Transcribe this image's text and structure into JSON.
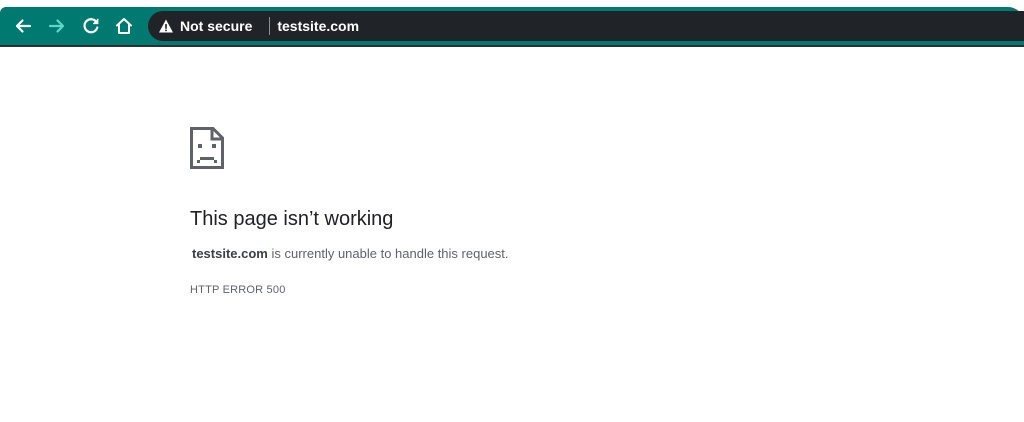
{
  "browser": {
    "nav_icons": [
      "back-arrow-icon",
      "forward-arrow-icon",
      "reload-icon",
      "home-icon"
    ],
    "security_icon": "warning-triangle-icon",
    "security_label": "Not secure",
    "url": "testsite.com",
    "colors": {
      "toolbar": "#007a70",
      "omnibox": "#202428",
      "nav_back": "#ffffff",
      "nav_forward": "#5fd6c9"
    }
  },
  "error_page": {
    "icon": "sad-page-icon",
    "title": "This page isn’t working",
    "host": "testsite.com",
    "message": " is currently unable to handle this request.",
    "error_code": "HTTP ERROR 500"
  }
}
